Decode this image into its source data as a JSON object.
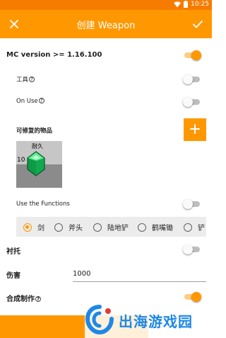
{
  "status_bar": {
    "time": "10:25",
    "wifi_icon": "wifi-icon",
    "battery_icon": "battery-icon"
  },
  "app_bar": {
    "title": "创建 Weapon",
    "close_icon": "close-icon",
    "confirm_icon": "check-icon"
  },
  "form": {
    "mc_version_label": "MC version >= 1.16.100",
    "mc_version_enabled": true,
    "tool_label": "工具",
    "tool_enabled": false,
    "on_use_label": "On Use",
    "on_use_enabled": false,
    "repairable_items_label": "可修复的物品",
    "add_icon": "plus-icon",
    "repair_item": {
      "name": "耐久",
      "count": "10",
      "icon": "emerald-icon"
    },
    "use_functions_label": "Use the Functions",
    "use_functions_enabled": false,
    "weapon_types": [
      {
        "label": "剑",
        "selected": true
      },
      {
        "label": "斧头",
        "selected": false
      },
      {
        "label": "陆地铲",
        "selected": false
      },
      {
        "label": "鹤嘴锄",
        "selected": false
      },
      {
        "label": "铲",
        "selected": false
      }
    ],
    "offhand_label": "衬托",
    "offhand_enabled": false,
    "damage_label": "伤害",
    "damage_value": "1000",
    "crafting_label": "合成制作",
    "crafting_enabled": true
  },
  "watermark": {
    "text": "出海游戏园"
  },
  "colors": {
    "primary": "#ff9800",
    "status_bar": "#f57c00",
    "accent_blue": "#1e88e5"
  }
}
